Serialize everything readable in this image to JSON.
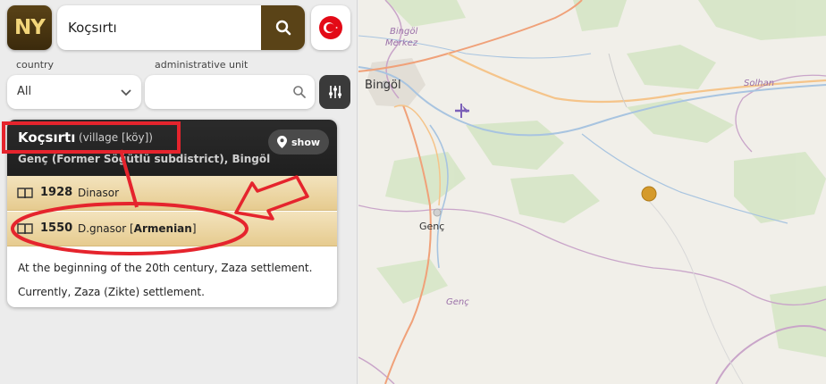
{
  "header": {
    "logo_text": "NY",
    "search_value": "Koçsırtı",
    "search_icon": "search-icon",
    "country_flag": "turkey-flag-icon"
  },
  "filters": {
    "country_label": "country",
    "country_value": "All",
    "admin_label": "administrative unit",
    "admin_value": "",
    "filter_icon": "sliders-icon"
  },
  "result": {
    "name": "Koçsırtı",
    "type": "(village [köy])",
    "region": "Genç (Former Söğütlü subdistrict), Bingöl",
    "show_label": "show",
    "names": [
      {
        "year": "1928",
        "name": "Dinasor",
        "lang": ""
      },
      {
        "year": "1550",
        "name": "D.gnasor",
        "lang": "Armenian"
      }
    ],
    "notes": [
      "At the beginning of the 20th century, Zaza settlement.",
      "Currently, Zaza (Zikte) settlement."
    ]
  },
  "map": {
    "labels": {
      "bingol_merkez_1": "Bingöl",
      "bingol_merkez_2": "Merkez",
      "bingol_city": "Bingöl",
      "solhan": "Solhan",
      "genc_town": "Genç",
      "genc_district": "Genç"
    },
    "marker_color": "#d59a2b",
    "accent_color": "#e5242d"
  }
}
